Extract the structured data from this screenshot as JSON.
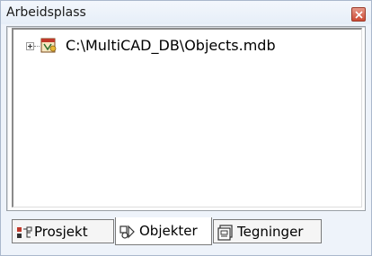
{
  "window": {
    "title": "Arbeidsplass",
    "close_icon": "close-icon"
  },
  "tree": {
    "items": [
      {
        "label": "C:\\MultiCAD_DB\\Objects.mdb",
        "icon": "database-icon",
        "expander": "expand-plus-icon"
      }
    ]
  },
  "tabs": [
    {
      "label": "Prosjekt",
      "icon": "project-tree-icon",
      "active": false
    },
    {
      "label": "Objekter",
      "icon": "objects-shapes-icon",
      "active": true
    },
    {
      "label": "Tegninger",
      "icon": "drawings-icon",
      "active": false
    }
  ]
}
